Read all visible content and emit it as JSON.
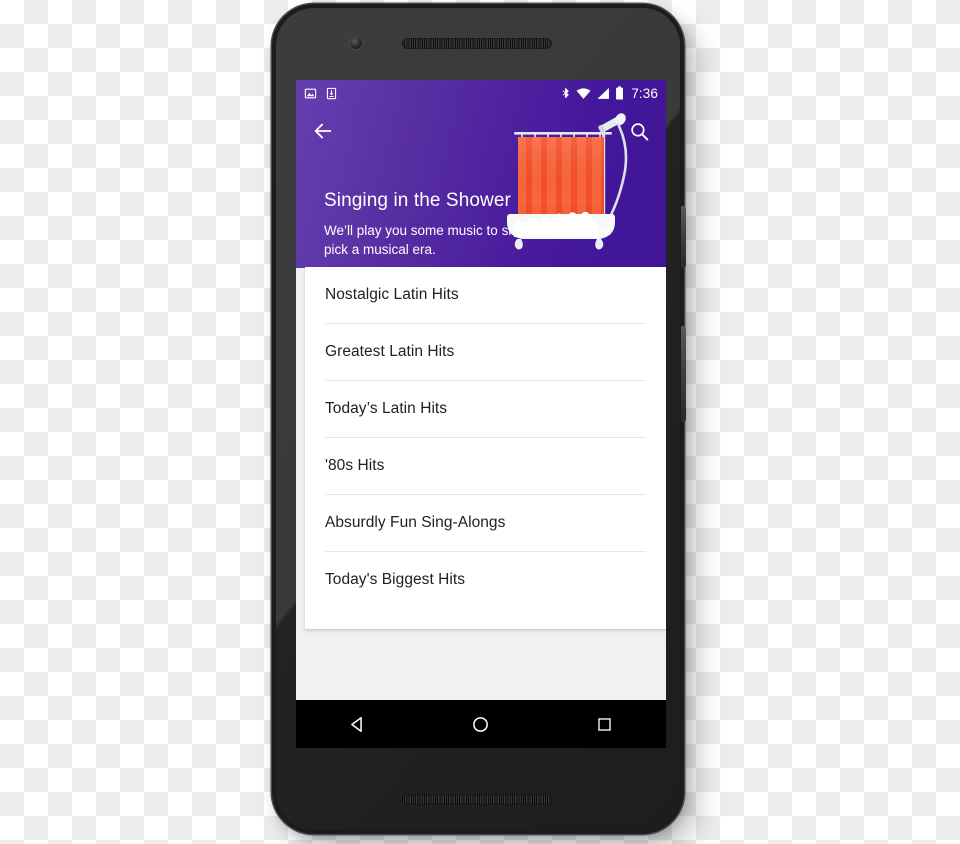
{
  "device": {
    "name": "android-phone",
    "front_camera": "camera-icon",
    "earpiece": "speaker-grille",
    "bottom_speaker": "speaker-grille",
    "power_button": "power-button",
    "volume_button": "volume-button"
  },
  "status_bar": {
    "left_icons": [
      "image-notification-icon",
      "download-notification-icon"
    ],
    "right_icons": [
      "bluetooth-icon",
      "wifi-icon",
      "signal-icon",
      "battery-icon"
    ],
    "clock": "7:36"
  },
  "action_bar": {
    "back_icon": "back-arrow-icon",
    "search_icon": "search-icon"
  },
  "header": {
    "title": "Singing in the Shower",
    "subtitle": "We’ll play you some music to sing along to. Just pick a musical era.",
    "illustration": "shower-curtain-bathtub-illustration",
    "background_color": "#4a1d9e",
    "curtain_color": "#f4502a"
  },
  "list": {
    "items": [
      {
        "label": "Nostalgic Latin Hits"
      },
      {
        "label": "Greatest Latin Hits"
      },
      {
        "label": "Today’s Latin Hits"
      },
      {
        "label": "'80s Hits"
      },
      {
        "label": "Absurdly Fun Sing-Alongs"
      },
      {
        "label": "Today's Biggest Hits"
      }
    ]
  },
  "nav_bar": {
    "back": "nav-back-icon",
    "home": "nav-home-icon",
    "recents": "nav-recents-icon"
  }
}
